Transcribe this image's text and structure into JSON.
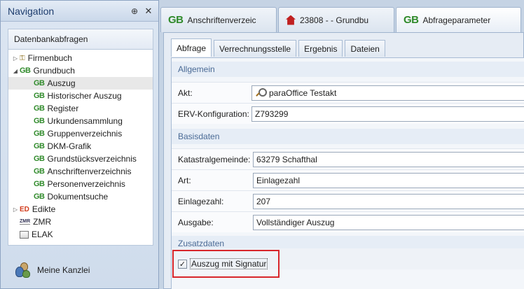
{
  "nav": {
    "title": "Navigation",
    "pin_glyph": "⊕",
    "close_glyph": "✕",
    "section": "Datenbankabfragen",
    "items": [
      {
        "label": "Firmenbuch",
        "level": 0,
        "twisty": "▷",
        "icon": "keys-icon"
      },
      {
        "label": "Grundbuch",
        "level": 0,
        "twisty": "◢",
        "icon": "gb-icon"
      },
      {
        "label": "Auszug",
        "level": 1,
        "icon": "gb-icon",
        "selected": true
      },
      {
        "label": "Historischer Auszug",
        "level": 1,
        "icon": "gb-icon"
      },
      {
        "label": "Register",
        "level": 1,
        "icon": "gb-icon"
      },
      {
        "label": "Urkundensammlung",
        "level": 1,
        "icon": "gb-icon"
      },
      {
        "label": "Gruppenverzeichnis",
        "level": 1,
        "icon": "gb-icon"
      },
      {
        "label": "DKM-Grafik",
        "level": 1,
        "icon": "gb-icon"
      },
      {
        "label": "Grundstücksverzeichnis",
        "level": 1,
        "icon": "gb-icon"
      },
      {
        "label": "Anschriftenverzeichnis",
        "level": 1,
        "icon": "gb-icon"
      },
      {
        "label": "Personenverzeichnis",
        "level": 1,
        "icon": "gb-icon"
      },
      {
        "label": "Dokumentsuche",
        "level": 1,
        "icon": "gb-icon"
      },
      {
        "label": "Edikte",
        "level": 0,
        "twisty": "▷",
        "icon": "edikte-icon"
      },
      {
        "label": "ZMR",
        "level": 0,
        "icon": "zmr-icon"
      },
      {
        "label": "ELAK",
        "level": 0,
        "icon": "elak-icon"
      }
    ],
    "footer": "Meine Kanzlei"
  },
  "icons": {
    "gb": "GB",
    "ed": "ED",
    "zmr": "ZMR"
  },
  "doc_tabs": [
    {
      "label": "Anschriftenverzeic",
      "icon": "gb-icon"
    },
    {
      "label": "23808 -   - Grundbu",
      "icon": "house-icon"
    },
    {
      "label": "Abfrageparameter",
      "icon": "gb-icon",
      "active": true
    }
  ],
  "sub_tabs": [
    "Abfrage",
    "Verrechnungsstelle",
    "Ergebnis",
    "Dateien"
  ],
  "form": {
    "section_allgemein": "Allgemein",
    "akt_label": "Akt:",
    "akt_value": "paraOffice Testakt",
    "erv_label": "ERV-Konfiguration:",
    "erv_value": "Z793299",
    "section_basis": "Basisdaten",
    "kg_label": "Katastralgemeinde:",
    "kg_value": "63279 Schafthal",
    "art_label": "Art:",
    "art_value": "Einlagezahl",
    "ez_label": "Einlagezahl:",
    "ez_value": "207",
    "ausgabe_label": "Ausgabe:",
    "ausgabe_value": "Vollständiger Auszug",
    "section_zusatz": "Zusatzdaten",
    "signatur_label": "Auszug mit Signatur",
    "signatur_checked": true,
    "check_glyph": "✓"
  },
  "colors": {
    "highlight": "#d8262b",
    "gb_green": "#2f8a2a"
  }
}
